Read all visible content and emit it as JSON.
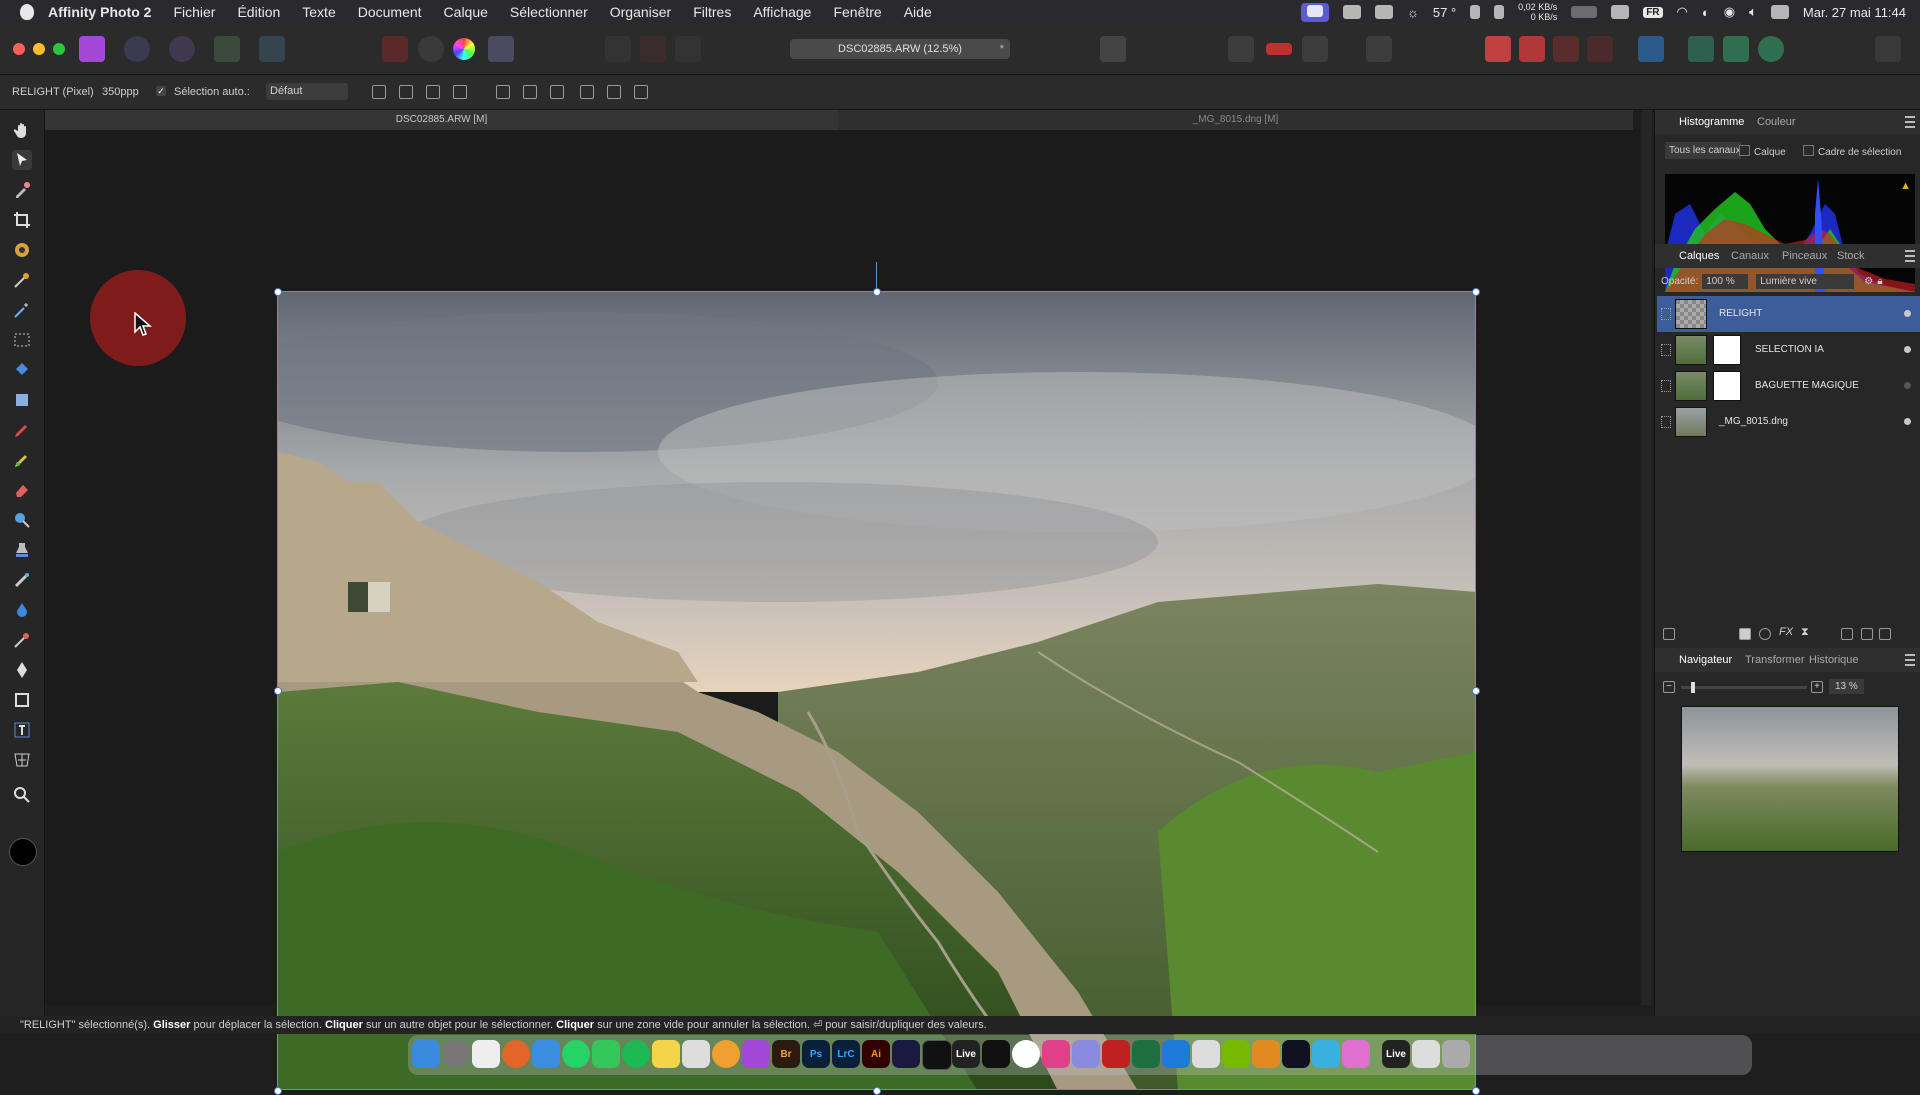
{
  "menubar": {
    "app_name": "Affinity Photo 2",
    "items": [
      "Fichier",
      "Édition",
      "Texte",
      "Document",
      "Calque",
      "Sélectionner",
      "Organiser",
      "Filtres",
      "Affichage",
      "Fenêtre",
      "Aide"
    ],
    "tray": {
      "temperature": "57 °",
      "net_up": "0,02 KB/s",
      "net_down": "0 KB/s",
      "input_source": "FR",
      "clock": "Mar. 27 mai  11:44"
    }
  },
  "toolbar": {
    "document_title": "DSC02885.ARW (12.5%)",
    "modified_mark": "*"
  },
  "context_bar": {
    "layer_label": "RELIGHT (Pixel)",
    "dpi": "350ppp",
    "auto_select_check": "✓",
    "auto_select_label": "Sélection auto.:",
    "auto_select_value": "Défaut"
  },
  "document_tabs": [
    {
      "label": "DSC02885.ARW [M]"
    },
    {
      "label": "_MG_8015.dng [M]"
    }
  ],
  "histogram_panel": {
    "tabs": [
      "Histogramme",
      "Couleur"
    ],
    "channel_label": "Tous les canaux",
    "layer_option": "Calque",
    "marquee_option": "Cadre de sélection"
  },
  "layers_panel": {
    "tabs": [
      "Calques",
      "Canaux",
      "Pinceaux",
      "Stock"
    ],
    "opacity_label": "Opacité:",
    "opacity_value": "100 %",
    "blend_mode": "Lumière vive",
    "layers": [
      {
        "name": "RELIGHT"
      },
      {
        "name": "SELECTION IA"
      },
      {
        "name": "BAGUETTE MAGIQUE"
      },
      {
        "name": "_MG_8015.dng"
      }
    ]
  },
  "navigator_panel": {
    "tabs": [
      "Navigateur",
      "Transformer",
      "Historique"
    ],
    "zoom": "13 %",
    "zoom_level": 0.08
  },
  "statusbar": {
    "part1": "\"RELIGHT\" sélectionné(s).",
    "b1": "Glisser",
    "part2": "pour déplacer la sélection.",
    "b2": "Cliquer",
    "part3": "sur un autre objet pour le sélectionner.",
    "b3": "Cliquer",
    "part4": "sur une zone vide pour annuler la sélection. ⏎ pour saisir/dupliquer des valeurs."
  },
  "dock": {
    "labels": [
      "Br",
      "Ps",
      "LrC",
      "Ai",
      "Live"
    ]
  },
  "colors": {
    "accent": "#3d5d9a",
    "spotlight": "#a01e1e",
    "histogram_red": "#e02020",
    "histogram_green": "#20c020",
    "histogram_blue": "#2030e0"
  }
}
